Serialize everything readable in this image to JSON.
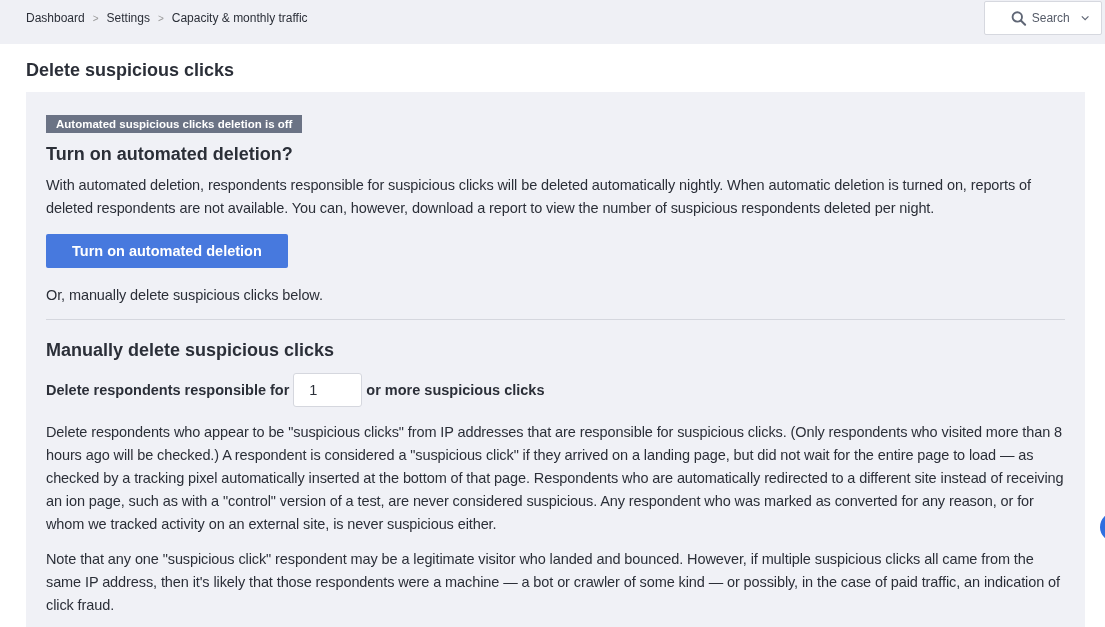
{
  "breadcrumbs": [
    "Dashboard",
    "Settings",
    "Capacity & monthly traffic"
  ],
  "breadcrumb_separator": ">",
  "search": {
    "label": "Search"
  },
  "page_title": "Delete suspicious clicks",
  "automation": {
    "status_badge": "Automated suspicious clicks deletion is off",
    "on": false,
    "heading": "Turn on automated deletion?",
    "description": "With automated deletion, respondents responsible for suspicious clicks will be deleted automatically nightly. When automatic deletion is turned on, reports of deleted respondents are not available. You can, however, download a report to view the number of suspicious respondents deleted per night.",
    "button": "Turn on automated deletion",
    "note": "Or, manually delete suspicious clicks below."
  },
  "manual": {
    "heading": "Manually delete suspicious clicks",
    "label_before": "Delete respondents responsible for",
    "value": "1",
    "label_after": "or more suspicious clicks",
    "paragraphs": [
      "Delete respondents who appear to be \"suspicious clicks\" from IP addresses that are responsible for suspicious clicks. (Only respondents who visited more than 8 hours ago will be checked.) A respondent is considered a \"suspicious click\" if they arrived on a landing page, but did not wait for the entire page to load — as checked by a tracking pixel automatically inserted at the bottom of that page. Respondents who are automatically redirected to a different site instead of receiving an ion page, such as with a \"control\" version of a test, are never considered suspicious. Any respondent who was marked as converted for any reason, or for whom we tracked activity on an external site, is never suspicious either.",
      "Note that any one \"suspicious click\" respondent may be a legitimate visitor who landed and bounced. However, if multiple suspicious clicks all came from the same IP address, then it's likely that those respondents were a machine — a bot or crawler of some kind — or possibly, in the case of paid traffic, an indication of click fraud."
    ]
  }
}
